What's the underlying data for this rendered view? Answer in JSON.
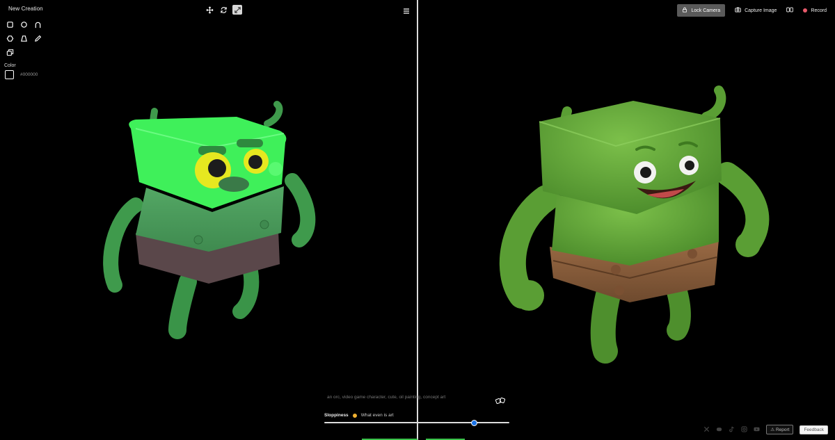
{
  "app": {
    "title": "New Creation"
  },
  "tools": [
    {
      "name": "square-tool"
    },
    {
      "name": "circle-tool"
    },
    {
      "name": "arch-tool"
    },
    {
      "name": "hexagon-tool"
    },
    {
      "name": "trapezoid-tool"
    },
    {
      "name": "pencil-tool"
    },
    {
      "name": "layers-tool"
    }
  ],
  "color": {
    "label": "Color",
    "value": "#000000",
    "swatch": "#000000"
  },
  "top_right": {
    "lock_camera": "Lock Camera",
    "capture_image": "Capture Image",
    "record": "Record"
  },
  "prompt": {
    "text": "an orc, video game character, cute, oil painting, concept art"
  },
  "sloppiness": {
    "label": "Sloppiness",
    "description": "What even is art",
    "value": 0.81
  },
  "footer": {
    "report": "Report",
    "feedback": "Feedback"
  },
  "colors": {
    "accent_blue": "#1a73e8",
    "record_red": "#e85a6b",
    "orc_green": "#5fbf3a"
  }
}
